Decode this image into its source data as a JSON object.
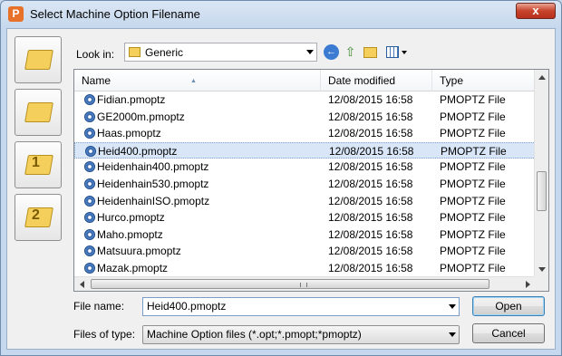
{
  "window": {
    "title": "Select Machine Option Filename",
    "close_label": "x",
    "app_icon_letter": "P"
  },
  "toolbar": {
    "look_in_label": "Look in:",
    "look_in_value": "Generic"
  },
  "columns": {
    "name": "Name",
    "date": "Date modified",
    "type": "Type"
  },
  "files": [
    {
      "name": "Fidian.pmoptz",
      "date": "12/08/2015 16:58",
      "type": "PMOPTZ File"
    },
    {
      "name": "GE2000m.pmoptz",
      "date": "12/08/2015 16:58",
      "type": "PMOPTZ File"
    },
    {
      "name": "Haas.pmoptz",
      "date": "12/08/2015 16:58",
      "type": "PMOPTZ File"
    },
    {
      "name": "Heid400.pmoptz",
      "date": "12/08/2015 16:58",
      "type": "PMOPTZ File",
      "selected": true
    },
    {
      "name": "Heidenhain400.pmoptz",
      "date": "12/08/2015 16:58",
      "type": "PMOPTZ File"
    },
    {
      "name": "Heidenhain530.pmoptz",
      "date": "12/08/2015 16:58",
      "type": "PMOPTZ File"
    },
    {
      "name": "HeidenhainISO.pmoptz",
      "date": "12/08/2015 16:58",
      "type": "PMOPTZ File"
    },
    {
      "name": "Hurco.pmoptz",
      "date": "12/08/2015 16:58",
      "type": "PMOPTZ File"
    },
    {
      "name": "Maho.pmoptz",
      "date": "12/08/2015 16:58",
      "type": "PMOPTZ File"
    },
    {
      "name": "Matsuura.pmoptz",
      "date": "12/08/2015 16:58",
      "type": "PMOPTZ File"
    },
    {
      "name": "Mazak.pmoptz",
      "date": "12/08/2015 16:58",
      "type": "PMOPTZ File"
    }
  ],
  "places": [
    {
      "icon": "computer-folder-icon",
      "label": ""
    },
    {
      "icon": "star-folder-icon",
      "label": ""
    },
    {
      "icon": "folder-1-icon",
      "label": "1"
    },
    {
      "icon": "folder-2-icon",
      "label": "2"
    }
  ],
  "form": {
    "file_name_label": "File name:",
    "file_name_value": "Heid400.pmoptz",
    "file_type_label": "Files of type:",
    "file_type_value": "Machine Option files (*.opt;*.pmopt;*pmoptz)"
  },
  "buttons": {
    "open": "Open",
    "cancel": "Cancel"
  }
}
